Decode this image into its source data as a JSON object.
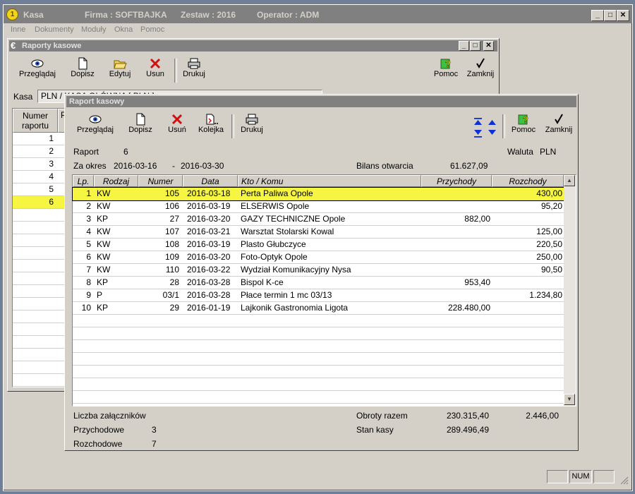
{
  "app": {
    "title": "Kasa",
    "firma": "Firma : SOFTBAJKA",
    "zestaw": "Zestaw : 2016",
    "operator": "Operator : ADM",
    "logo_char": "1"
  },
  "menu": [
    "Inne",
    "Dokumenty",
    "Moduły",
    "Okna",
    "Pomoc"
  ],
  "raporty": {
    "title": "Raporty kasowe",
    "toolbar": {
      "przegladaj": "Przeglądaj",
      "dopisz": "Dopisz",
      "edytuj": "Edytuj",
      "usun": "Usun",
      "drukuj": "Drukuj",
      "pomoc": "Pomoc",
      "zamknij": "Zamknij"
    },
    "kasa_label": "Kasa",
    "kasa_value": "PLN / KASA GŁÓWNA [ PLN ]",
    "col_numer": "Numer raportu",
    "col_p": "P",
    "numbers": [
      "1",
      "2",
      "3",
      "4",
      "5",
      "6"
    ]
  },
  "raport": {
    "title": "Raport kasowy",
    "toolbar": {
      "przegladaj": "Przeglądaj",
      "dopisz": "Dopisz",
      "usun": "Usuń",
      "kolejka": "Kolejka",
      "drukuj": "Drukuj",
      "pomoc": "Pomoc",
      "zamknij": "Zamknij"
    },
    "raport_label": "Raport",
    "raport_number": "6",
    "waluta_label": "Waluta",
    "waluta_value": "PLN",
    "okres_label": "Za okres",
    "okres_od": "2016-03-16",
    "okres_sep": "-",
    "okres_do": "2016-03-30",
    "bilans_label": "Bilans otwarcia",
    "bilans_value": "61.627,09",
    "columns": {
      "lp": "Lp.",
      "rodzaj": "Rodzaj",
      "numer": "Numer",
      "data": "Data",
      "kto": "Kto / Komu",
      "przychody": "Przychody",
      "rozchody": "Rozchody"
    },
    "rows": [
      {
        "lp": "1",
        "rodzaj": "KW",
        "numer": "105",
        "data": "2016-03-18",
        "kto": "Perta Paliwa Opole",
        "przychody": "",
        "rozchody": "430,00"
      },
      {
        "lp": "2",
        "rodzaj": "KW",
        "numer": "106",
        "data": "2016-03-19",
        "kto": "ELSERWIS Opole",
        "przychody": "",
        "rozchody": "95,20"
      },
      {
        "lp": "3",
        "rodzaj": "KP",
        "numer": "27",
        "data": "2016-03-20",
        "kto": "GAZY TECHNICZNE Opole",
        "przychody": "882,00",
        "rozchody": ""
      },
      {
        "lp": "4",
        "rodzaj": "KW",
        "numer": "107",
        "data": "2016-03-21",
        "kto": "Warsztat Stolarski Kowal",
        "przychody": "",
        "rozchody": "125,00"
      },
      {
        "lp": "5",
        "rodzaj": "KW",
        "numer": "108",
        "data": "2016-03-19",
        "kto": "Plasto  Głubczyce",
        "przychody": "",
        "rozchody": "220,50"
      },
      {
        "lp": "6",
        "rodzaj": "KW",
        "numer": "109",
        "data": "2016-03-20",
        "kto": "Foto-Optyk Opole",
        "przychody": "",
        "rozchody": "250,00"
      },
      {
        "lp": "7",
        "rodzaj": "KW",
        "numer": "110",
        "data": "2016-03-22",
        "kto": "Wydział Komunikacyjny Nysa",
        "przychody": "",
        "rozchody": "90,50"
      },
      {
        "lp": "8",
        "rodzaj": "KP",
        "numer": "28",
        "data": "2016-03-28",
        "kto": "Bispol K-ce",
        "przychody": "953,40",
        "rozchody": ""
      },
      {
        "lp": "9",
        "rodzaj": "P",
        "numer": "03/1",
        "data": "2016-03-28",
        "kto": "Płace termin 1 mc 03/13",
        "przychody": "",
        "rozchody": "1.234,80"
      },
      {
        "lp": "10",
        "rodzaj": "KP",
        "numer": "29",
        "data": "2016-01-19",
        "kto": "Lajkonik  Gastronomia Ligota",
        "przychody": "228.480,00",
        "rozchody": ""
      }
    ],
    "footer": {
      "zalaczniki_label": "Liczba załączników",
      "przychodowe_label": "Przychodowe",
      "przychodowe_value": "3",
      "rozchodowe_label": "Rozchodowe",
      "rozchodowe_value": "7",
      "obroty_label": "Obroty razem",
      "obroty_przychody": "230.315,40",
      "obroty_rozchody": "2.446,00",
      "stan_label": "Stan kasy",
      "stan_value": "289.496,49"
    }
  },
  "status": {
    "num": "NUM"
  },
  "colors": {
    "highlight": "#f5f542",
    "title_inactive": "#808080",
    "window_bg": "#d4d0c8"
  }
}
